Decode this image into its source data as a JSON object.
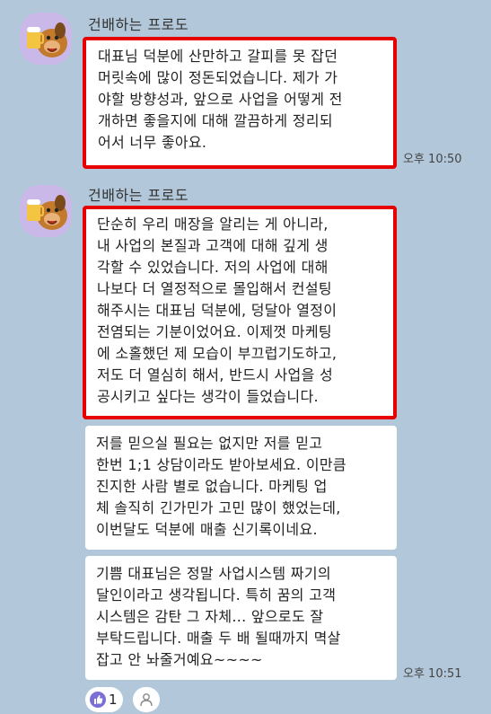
{
  "messages": [
    {
      "sender": "건배하는 프로도",
      "lines": [
        "대표님 덕분에 산만하고 갈피를 못 잡던",
        "머릿속에 많이 정돈되었습니다. 제가 가",
        "야할 방향성과, 앞으로 사업을 어떻게 전",
        "개하면 좋을지에 대해 깔끔하게 정리되",
        "어서 너무 좋아요."
      ],
      "time": "오후 10:50"
    },
    {
      "sender": "건배하는 프로도",
      "lines": [
        "단순히 우리 매장을 알리는 게 아니라,",
        "내 사업의 본질과 고객에 대해 깊게 생",
        "각할 수 있었습니다. 저의 사업에 대해",
        "나보다 더 열정적으로 몰입해서 컨설팅",
        "해주시는 대표님 덕분에, 덩달아 열정이",
        "전염되는 기분이었어요. 이제껏 마케팅",
        "에 소홀했던 제 모습이 부끄럽기도하고,",
        "저도 더 열심히 해서, 반드시 사업을 성",
        "공시키고 싶다는 생각이 들었습니다."
      ]
    },
    {
      "lines": [
        "저를 믿으실 필요는 없지만 저를 믿고",
        "한번 1;1 상담이라도 받아보세요. 이만큼",
        "진지한 사람 별로 없습니다. 마케팅 업",
        "체 솔직히 긴가민가 고민 많이 했었는데,",
        "이번달도 덕분에 매출 신기록이네요."
      ]
    },
    {
      "lines": [
        "기쁨 대표님은 정말 사업시스템 짜기의",
        "달인이라고 생각됩니다. 특히 꿈의 고객",
        "시스템은 감탄 그 자체...  앞으로도 잘",
        "부탁드립니다. 매출 두 배 될때까지 멱살",
        "잡고 안 놔줄거예요~~~~"
      ],
      "time": "오후 10:51"
    }
  ],
  "reaction": {
    "icon": "thumbs-up-icon",
    "count": "1",
    "color": "#7b6fd6"
  },
  "colors": {
    "background": "#b2c7d9",
    "highlight": "#e60000",
    "bubble": "#ffffff"
  }
}
